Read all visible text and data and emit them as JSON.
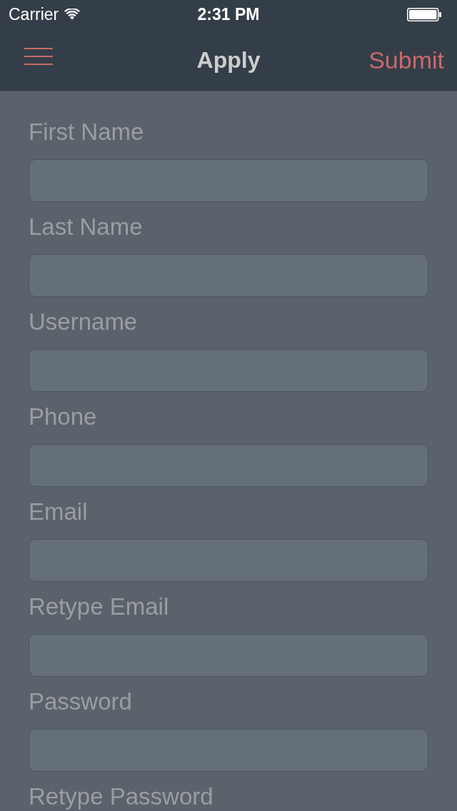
{
  "status_bar": {
    "carrier": "Carrier",
    "time": "2:31 PM"
  },
  "nav_bar": {
    "title": "Apply",
    "right_button": "Submit"
  },
  "form": {
    "fields": [
      {
        "label": "First Name"
      },
      {
        "label": "Last Name"
      },
      {
        "label": "Username"
      },
      {
        "label": "Phone"
      },
      {
        "label": "Email"
      },
      {
        "label": "Retype Email"
      },
      {
        "label": "Password"
      },
      {
        "label": "Retype Password"
      }
    ]
  }
}
